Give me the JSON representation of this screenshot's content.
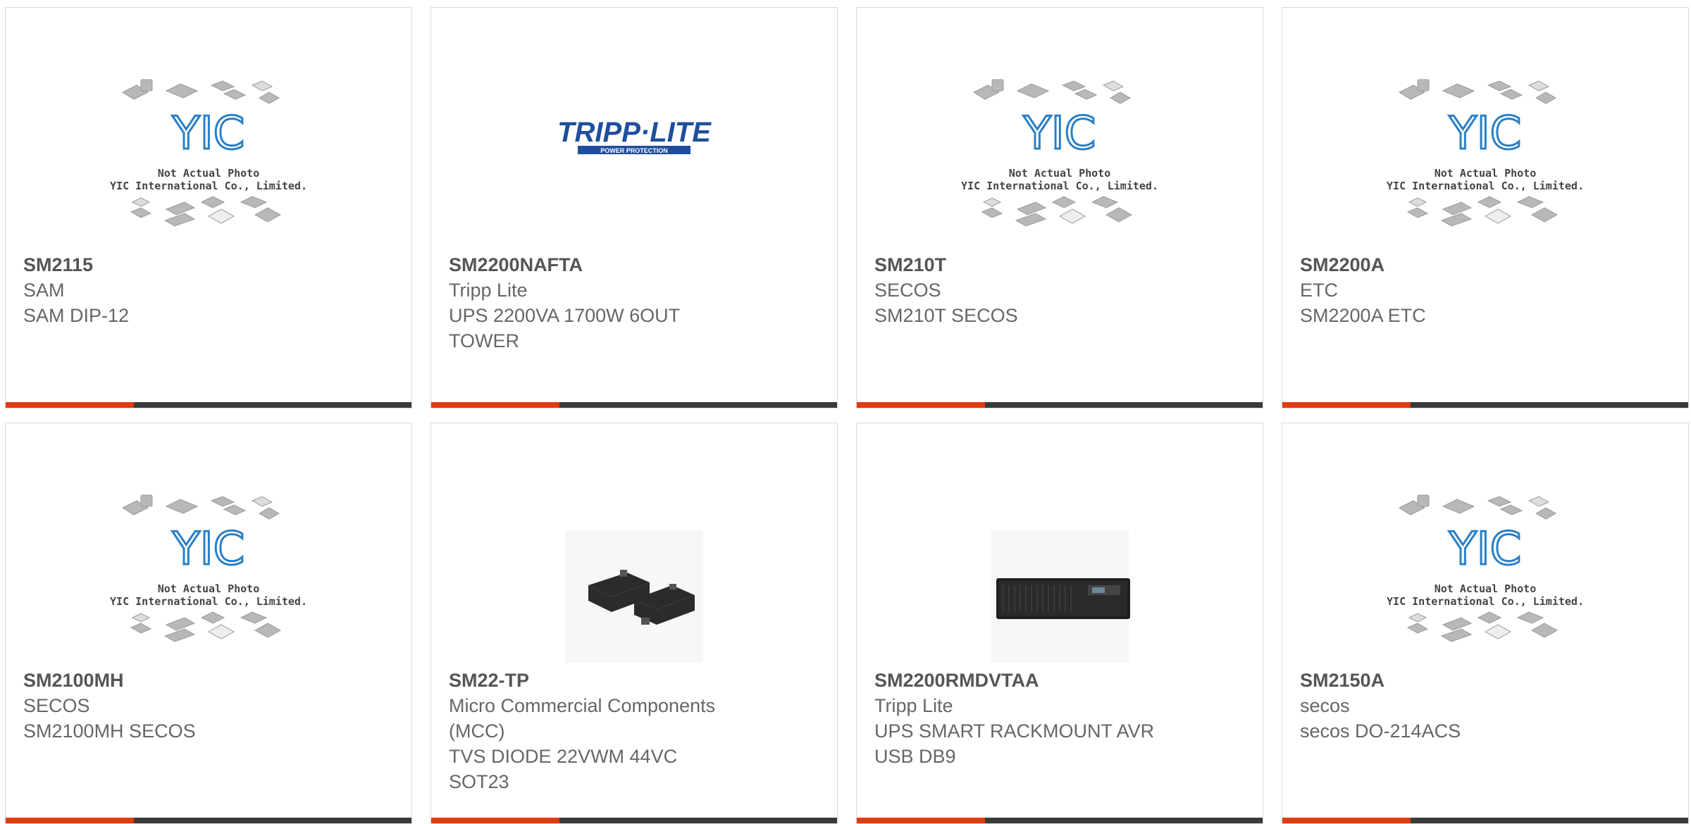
{
  "colors": {
    "accent": "#e03c10",
    "bar": "#3a3a3a",
    "border": "#d9d9d9",
    "text": "#666666",
    "yic_blue": "#2a7fc4",
    "tripp_blue": "#1f4e9c"
  },
  "placeholder": {
    "line1": "Not Actual Photo",
    "line2": "YIC International Co., Limited.",
    "logo": "YIC"
  },
  "tripplite_logo": {
    "name": "TRIPP·LITE",
    "tagline": "POWER PROTECTION"
  },
  "products": [
    {
      "part": "SM2115",
      "maker": "SAM",
      "desc": [
        "SAM DIP-12"
      ],
      "image": "placeholder"
    },
    {
      "part": "SM2200NAFTA",
      "maker": "Tripp Lite",
      "desc": [
        "UPS 2200VA 1700W 6OUT",
        "TOWER"
      ],
      "image": "tripplite-logo"
    },
    {
      "part": "SM210T",
      "maker": "SECOS",
      "desc": [
        "SM210T SECOS"
      ],
      "image": "placeholder"
    },
    {
      "part": "SM2200A",
      "maker": "ETC",
      "desc": [
        "SM2200A ETC"
      ],
      "image": "placeholder"
    },
    {
      "part": "SM2100MH",
      "maker": "SECOS",
      "desc": [
        "SM2100MH SECOS"
      ],
      "image": "placeholder"
    },
    {
      "part": "SM22-TP",
      "maker": "Micro Commercial Components",
      "desc": [
        "(MCC)",
        "TVS DIODE 22VWM 44VC",
        "SOT23"
      ],
      "image": "sot23-photo"
    },
    {
      "part": "SM2200RMDVTAA",
      "maker": "Tripp Lite",
      "desc": [
        "UPS SMART RACKMOUNT AVR",
        "USB DB9"
      ],
      "image": "rackmount-photo"
    },
    {
      "part": "SM2150A",
      "maker": "secos",
      "desc": [
        "secos DO-214ACS"
      ],
      "image": "placeholder"
    }
  ]
}
